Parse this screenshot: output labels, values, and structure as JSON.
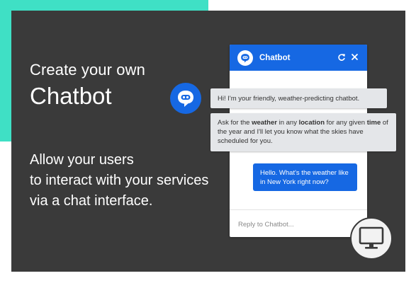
{
  "hero": {
    "line1": "Create your own",
    "line2": "Chatbot",
    "description": [
      "Allow your users",
      "to interact with your services",
      "via a chat interface."
    ]
  },
  "chat": {
    "title": "Chatbot",
    "messages": [
      {
        "sender": "bot",
        "text": "Hi! I'm your friendly, weather-predicting chatbot."
      },
      {
        "sender": "bot",
        "text": "Ask for the weather in any location for any given time of the year and I'll let you know what the skies have scheduled for you."
      },
      {
        "sender": "user",
        "text": "Hello. What's the weather like in New York right now?"
      }
    ],
    "reply_placeholder": "Reply to Chatbot..."
  },
  "icons": {
    "bot": "chat-bubble-icon",
    "refresh": "refresh-icon",
    "close": "close-icon",
    "monitor": "monitor-icon"
  },
  "colors": {
    "accent": "#1668e3",
    "teal": "#3fe0c5",
    "panel": "#3a3a3a",
    "bot_bubble": "#e4e6e9"
  }
}
